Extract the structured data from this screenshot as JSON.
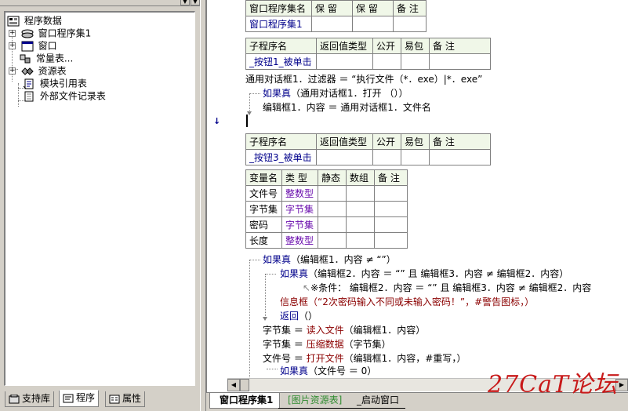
{
  "left_panel": {
    "tree": [
      {
        "label": "程序数据",
        "icon": "program-data-icon",
        "expander": ""
      },
      {
        "label": "窗口程序集1",
        "icon": "assembly-icon",
        "expander": "+"
      },
      {
        "label": "窗口",
        "icon": "window-icon",
        "expander": "+"
      },
      {
        "label": "常量表...",
        "icon": "constant-table-icon",
        "expander": ""
      },
      {
        "label": "资源表",
        "icon": "resource-icon",
        "expander": "+"
      },
      {
        "label": "模块引用表",
        "icon": "module-ref-icon",
        "expander": ""
      },
      {
        "label": "外部文件记录表",
        "icon": "external-file-icon",
        "expander": ""
      }
    ],
    "tabs": [
      {
        "label": "支持库",
        "icon": "support-library-icon"
      },
      {
        "label": "程序",
        "icon": "program-icon"
      },
      {
        "label": "属性",
        "icon": "properties-icon"
      }
    ]
  },
  "editor": {
    "assembly_table": {
      "headers": [
        "窗口程序集名",
        "保 留",
        "保 留",
        "备 注"
      ],
      "row": [
        "窗口程序集1",
        "",
        "",
        ""
      ]
    },
    "sub1_table": {
      "headers": [
        "子程序名",
        "返回值类型",
        "公开",
        "易包",
        "备 注"
      ],
      "row": [
        "_按钮1_被单击",
        "",
        "",
        "",
        ""
      ]
    },
    "sub1_lines": {
      "l1": "通用对话框1．过滤器 ＝ “执行文件（*．exe）|*．exe”",
      "l2_kw": "如果真",
      "l2_rest": "（通用对话框1．打开 （））",
      "l3": "编辑框1．内容 ＝ 通用对话框1．文件名"
    },
    "sub3_table": {
      "headers": [
        "子程序名",
        "返回值类型",
        "公开",
        "易包",
        "备 注"
      ],
      "row": [
        "_按钮3_被单击",
        "",
        "",
        "",
        ""
      ]
    },
    "var_table": {
      "headers": [
        "变量名",
        "类 型",
        "静态",
        "数组",
        "备 注"
      ],
      "rows": [
        [
          "文件号",
          "整数型",
          "",
          "",
          ""
        ],
        [
          "字节集",
          "字节集",
          "",
          "",
          ""
        ],
        [
          "密码",
          "字节集",
          "",
          "",
          ""
        ],
        [
          "长度",
          "整数型",
          "",
          "",
          ""
        ]
      ]
    },
    "sub3_lines": {
      "if1_kw": "如果真",
      "if1_rest": "（编辑框1．内容 ≠ “”）",
      "if2_kw": "如果真",
      "if2_rest": "（编辑框2．内容 ＝ “” 且 编辑框3．内容 ≠ 编辑框2．内容）",
      "cond": "※条件： 编辑框2．内容 ＝ “” 且 编辑框3．内容 ≠ 编辑框2．内容",
      "msg_fn": "信息框",
      "msg_rest": "（“2次密码输入不同或未输入密码！”，#警告图标，）",
      "ret_kw": "返回",
      "ret_rest": "（）",
      "l_read_a": "字节集 ＝ ",
      "l_read_fn": "读入文件",
      "l_read_b": "（编辑框1．内容）",
      "l_zip_a": "字节集 ＝ ",
      "l_zip_fn": "压缩数据",
      "l_zip_b": "（字节集）",
      "l_open_a": "文件号 ＝ ",
      "l_open_fn": "打开文件",
      "l_open_b": "（编辑框1．内容，#重写，）",
      "if3_kw": "如果真",
      "if3_rest": "（文件号 ＝ 0）"
    },
    "gutter_marks": {
      "arrow": "↓",
      "double_arrow": "▸▸"
    }
  },
  "doc_tabs": [
    {
      "label": "窗口程序集1",
      "state": "active"
    },
    {
      "label": "[图片资源表]",
      "state": "green"
    },
    {
      "label": "_启动窗口",
      "state": "normal"
    }
  ],
  "watermark": "27CaT论坛"
}
